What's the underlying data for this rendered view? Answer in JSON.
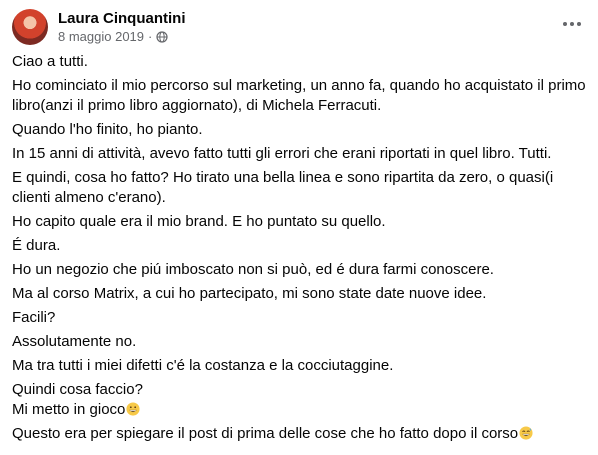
{
  "post": {
    "author": "Laura Cinquantini",
    "date": "8 maggio 2019",
    "separator": "·",
    "privacy_icon": "globe-icon",
    "options_icon": "more-options-icon",
    "paragraphs": [
      "Ciao a tutti.",
      "Ho cominciato il mio percorso sul marketing, un anno fa, quando ho acquistato il primo libro(anzi il primo libro aggiornato), di Michela Ferracuti.",
      "Quando l'ho finito, ho pianto.",
      "In 15 anni di attività, avevo fatto tutti gli errori che erani riportati in quel libro. Tutti.",
      "E quindi, cosa ho fatto? Ho tirato una bella linea e sono ripartita da zero, o quasi(i clienti almeno c'erano).",
      "Ho capito quale era il mio brand. E ho puntato su quello.",
      "É dura.",
      "Ho un negozio che piú imboscato non si può, ed é dura farmi conoscere.",
      "Ma al corso Matrix, a cui ho partecipato, mi sono state date nuove idee.",
      "Facili?",
      "Assolutamente no.",
      "Ma tra tutti i miei difetti c'é la costanza e la cocciutaggine."
    ],
    "line_quindi": "Quindi cosa faccio?",
    "line_gioco": "Mi metto in gioco",
    "line_last": "Questo era per spiegare il post di prima delle cose che ho fatto dopo il corso",
    "emoji_1": "grinning-face-icon",
    "emoji_2": "grinning-sweat-face-icon"
  }
}
